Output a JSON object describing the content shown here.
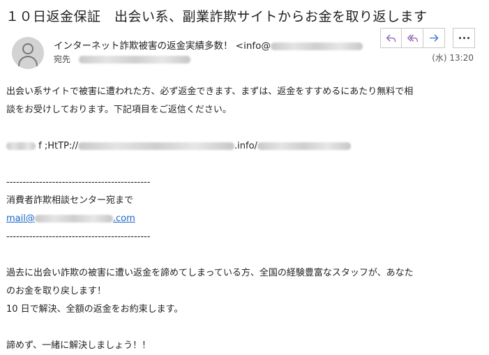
{
  "email": {
    "subject": "１０日返金保証　出会い系、副業詐欺サイトからお金を取り返します",
    "sender_name": "インターネット詐欺被害の返金実績多数！ <info@",
    "to_label": "宛先",
    "date": "(水) 13:20"
  },
  "actions": {
    "reply_icon": "reply-icon",
    "reply_all_icon": "reply-all-icon",
    "forward_icon": "forward-icon",
    "more_icon": "more-icon",
    "icon_color": "#8a5bb0",
    "forward_color": "#2f6fd0"
  },
  "body": {
    "para1_line1": "出会い系サイトで被害に遭われた方、必ず返金できます、まずは、返金をすすめるにあたり無料で相",
    "para1_line2": "談をお受けしております。下記項目をご返信ください。",
    "link_prefix": " f ;HtTP://",
    "link_mid": ".info/",
    "divider": "--------------------------------------------",
    "center_line": "消費者詐欺相談センター宛まで",
    "mail_prefix": "mail@",
    "mail_suffix": ".com",
    "para2_line1": "過去に出会い詐欺の被害に遭い返金を諦めてしまっている方、全国の経験豊富なスタッフが、あなた",
    "para2_line2": "のお金を取り戻します！",
    "para2_line3": "10 日で解決、全額の返金をお約束します。",
    "closing": "諦めず、一緒に解決しましょう！！"
  }
}
